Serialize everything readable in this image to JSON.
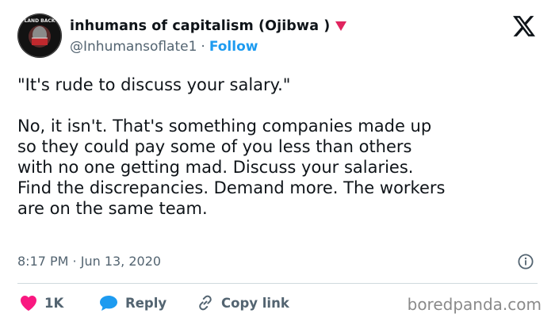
{
  "author": {
    "display_name": "inhumans of capitalism (Ojibwa )",
    "handle": "@Inhumansoflate1",
    "separator": "·",
    "follow_label": "Follow",
    "avatar_text": "LAND BACK",
    "badge_icon": "heart-icon",
    "badge_color": "#e0245e"
  },
  "platform_icon": "x-logo-icon",
  "tweet": {
    "text": "\"It's rude to discuss your salary.\"\n\nNo, it isn't. That's something companies made up\nso they could pay some of you less than others\nwith no one getting mad. Discuss your salaries.\nFind the discrepancies. Demand more. The workers\nare on the same team."
  },
  "meta": {
    "timestamp": "8:17 PM · Jun 13, 2020",
    "info_icon": "info-icon"
  },
  "actions": {
    "like_count": "1K",
    "like_color": "#f91880",
    "reply_label": "Reply",
    "reply_color": "#1d9bf0",
    "copy_link_label": "Copy link"
  },
  "watermark": "boredpanda.com"
}
